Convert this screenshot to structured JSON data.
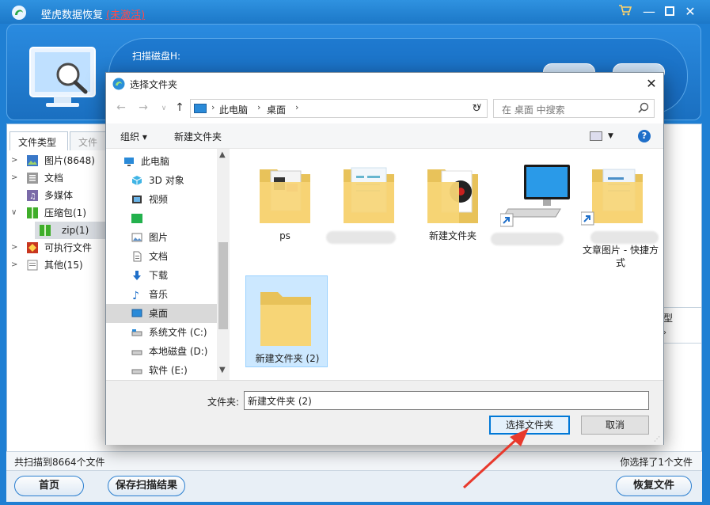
{
  "app": {
    "title": "壁虎数据恢复",
    "activation_status": "(未激活)",
    "scan_label": "扫描磁盘H:",
    "left_tabs": [
      "文件类型",
      "文件路"
    ],
    "tree": [
      {
        "label": "图片(8648)",
        "expanded": false,
        "icon": "picture-icon"
      },
      {
        "label": "文档",
        "expanded": false,
        "icon": "document-icon"
      },
      {
        "label": "多媒体",
        "expanded": null,
        "icon": "media-icon"
      },
      {
        "label": "压缩包(1)",
        "expanded": true,
        "icon": "archive-icon"
      },
      {
        "label": "zip(1)",
        "expanded": null,
        "icon": "zip-icon",
        "selected": true
      },
      {
        "label": "可执行文件",
        "expanded": false,
        "icon": "executable-icon"
      },
      {
        "label": "其他(15)",
        "expanded": false,
        "icon": "other-icon"
      }
    ],
    "right_peek": "型",
    "status_left": "共扫描到8664个文件",
    "status_right": "你选择了1个文件",
    "buttons": {
      "home": "首页",
      "save_scan": "保存扫描结果",
      "recover": "恢复文件"
    }
  },
  "dialog": {
    "title": "选择文件夹",
    "breadcrumb": [
      "此电脑",
      "桌面"
    ],
    "search_placeholder": "在 桌面 中搜索",
    "organize": "组织 ▾",
    "new_folder": "新建文件夹",
    "nav_items": [
      {
        "label": "此电脑",
        "icon": "pc-icon"
      },
      {
        "label": "3D 对象",
        "icon": "3d-objects-icon"
      },
      {
        "label": "视频",
        "icon": "video-icon"
      },
      {
        "label": "",
        "icon": "green-app-icon"
      },
      {
        "label": "图片",
        "icon": "pictures-icon"
      },
      {
        "label": "文档",
        "icon": "documents-icon"
      },
      {
        "label": "下载",
        "icon": "download-icon"
      },
      {
        "label": "音乐",
        "icon": "music-icon"
      },
      {
        "label": "桌面",
        "icon": "desktop-icon",
        "selected": true
      },
      {
        "label": "系统文件 (C:)",
        "icon": "drive-icon"
      },
      {
        "label": "本地磁盘 (D:)",
        "icon": "drive-icon"
      },
      {
        "label": "软件 (E:)",
        "icon": "drive-icon"
      }
    ],
    "files": [
      {
        "label": "ps",
        "icon": "folder-icon"
      },
      {
        "label": "",
        "icon": "folder-icon"
      },
      {
        "label": "新建文件夹",
        "icon": "folder-icon"
      },
      {
        "label": "",
        "icon": "computer-shortcut-icon"
      },
      {
        "label": "文章图片 - 快捷方式",
        "icon": "folder-shortcut-icon"
      },
      {
        "label": "新建文件夹 (2)",
        "icon": "folder-icon",
        "selected": true
      }
    ],
    "folder_label": "文件夹:",
    "folder_value": "新建文件夹 (2)",
    "select_button": "选择文件夹",
    "cancel_button": "取消"
  },
  "colors": {
    "app_blue": "#1f7fd3",
    "selection": "#cce8ff",
    "primary_border": "#0078d7",
    "annotation_arrow": "#e8392c",
    "activation_red": "#ff4a4a"
  }
}
